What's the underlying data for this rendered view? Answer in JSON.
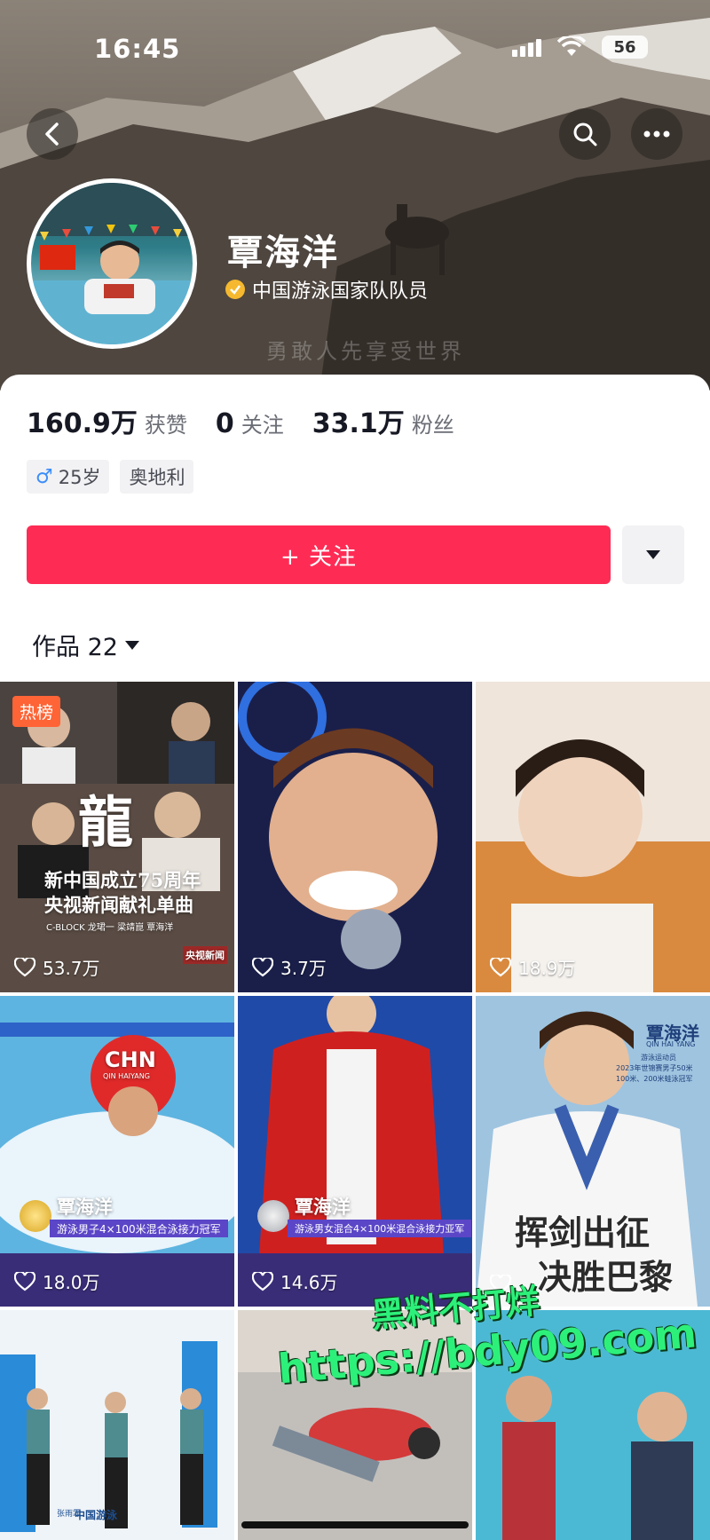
{
  "status_bar": {
    "time": "16:45",
    "battery": "56"
  },
  "profile": {
    "nickname": "覃海洋",
    "verification": "中国游泳国家队队员",
    "cover_slogan": "勇敢人先享受世界",
    "stats": [
      {
        "value": "160.9万",
        "label": "获赞"
      },
      {
        "value": "0",
        "label": "关注"
      },
      {
        "value": "33.1万",
        "label": "粉丝"
      }
    ],
    "tags": {
      "gender_symbol": "♂",
      "age": "25岁",
      "location": "奥地利"
    },
    "follow_label": "+ 关注",
    "works_tab": "作品 22"
  },
  "videos": [
    {
      "likes": "53.7万",
      "badge": "热榜",
      "title_main": "龍",
      "line1": "新中国成立75周年",
      "line2": "央视新闻献礼单曲",
      "credits": "C-BLOCK  龙珺一  梁靖崑  覃海洋",
      "corner": "央视新闻"
    },
    {
      "likes": "3.7万"
    },
    {
      "likes": "18.9万"
    },
    {
      "likes": "18.0万",
      "cap": "CHN",
      "cap_name": "QIN HAIYANG",
      "name": "覃海洋",
      "caption": "游泳男子4×100米混合泳接力冠军"
    },
    {
      "likes": "14.6万",
      "name": "覃海洋",
      "caption": "游泳男女混合4×100米混合泳接力亚军"
    },
    {
      "likes": "",
      "name": "覃海洋",
      "name_en": "QIN HAI YANG",
      "info": "游泳运动员",
      "info2": "2023年世锦赛男子50米",
      "info3": "100米、200米蛙泳冠军",
      "big_text": "挥剑出征",
      "big_text2": "决胜巴黎"
    },
    {
      "label": "中国游泳",
      "sub": "张雨霏"
    },
    {
      "likes": ""
    },
    {
      "likes": ""
    }
  ],
  "watermark": {
    "line1": "黑料不打烊",
    "line2": "https://bdy09.com"
  }
}
